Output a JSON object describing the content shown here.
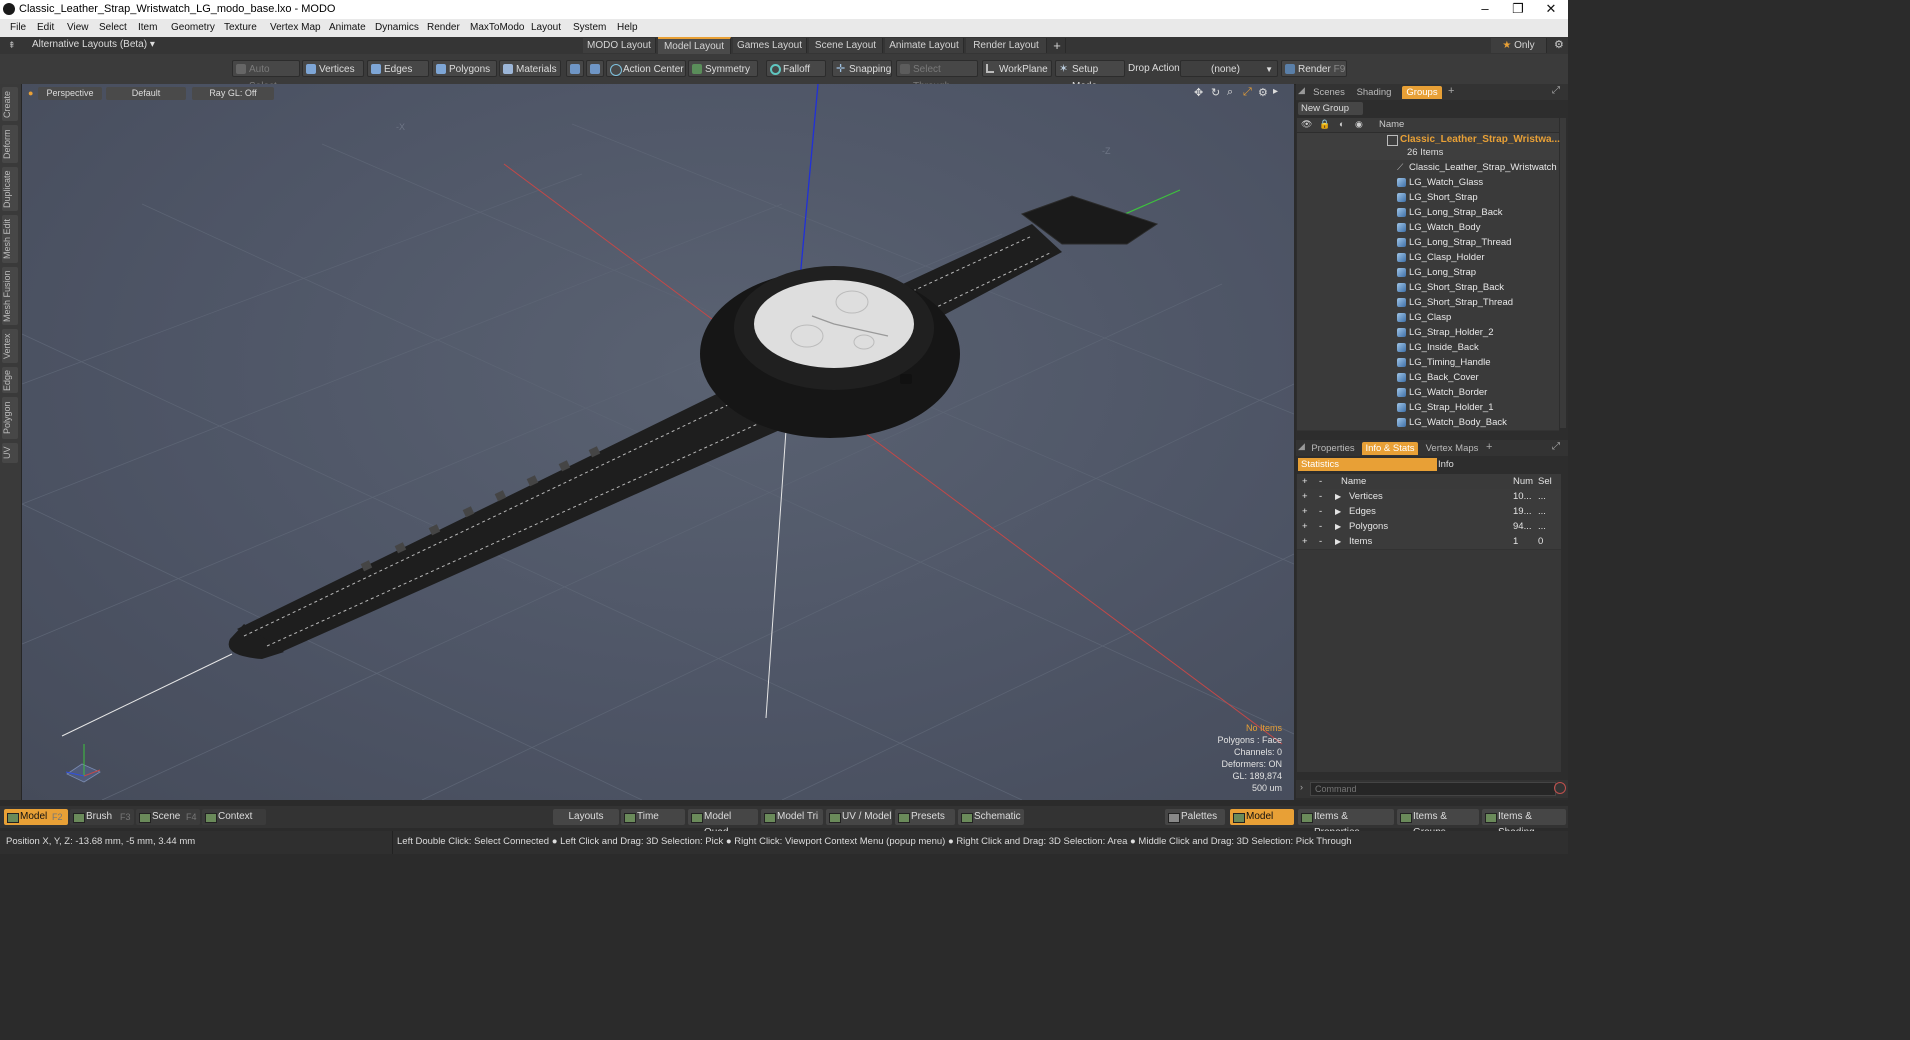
{
  "window": {
    "title": "Classic_Leather_Strap_Wristwatch_LG_modo_base.lxo - MODO"
  },
  "menu": [
    "File",
    "Edit",
    "View",
    "Select",
    "Item",
    "Geometry",
    "Texture",
    "Vertex Map",
    "Animate",
    "Dynamics",
    "Render",
    "MaxToModo",
    "Layout",
    "System",
    "Help"
  ],
  "layouts": {
    "selector": "Alternative Layouts (Beta)",
    "tabs": [
      "MODO Layout",
      "Model Layout",
      "Games Layout",
      "Scene Layout",
      "Animate Layout",
      "Render Layout"
    ],
    "active": "Model Layout",
    "add": "+",
    "only": "Only"
  },
  "toolbar": {
    "auto_select": "Auto Select",
    "vertices": "Vertices",
    "edges": "Edges",
    "polygons": "Polygons",
    "materials": "Materials",
    "action_center": "Action Center",
    "symmetry": "Symmetry",
    "falloff": "Falloff",
    "snapping": "Snapping",
    "select_through": "Select Through",
    "workplane": "WorkPlane",
    "setup_mode": "Setup Mode",
    "drop_action": "Drop Action",
    "drop_value": "(none)",
    "render": "Render",
    "render_key": "F9"
  },
  "left_tabs": [
    "Create",
    "Deform",
    "Duplicate",
    "Mesh Edit",
    "Mesh Fusion",
    "Vertex",
    "Edge",
    "Polygon",
    "UV"
  ],
  "viewport": {
    "view": "Perspective",
    "shading": "Default",
    "raygl": "Ray GL: Off",
    "stats": {
      "no_items": "No Items",
      "polygons": "Polygons : Face",
      "channels": "Channels: 0",
      "deformers": "Deformers: ON",
      "gl": "GL: 189,874",
      "scale": "500 um"
    }
  },
  "groups_panel": {
    "tabs": [
      "Scenes",
      "Shading",
      "Groups"
    ],
    "active": "Groups",
    "new_group": "New Group",
    "col_name": "Name",
    "group_name": "Classic_Leather_Strap_Wristwa...",
    "group_count": "26 Items",
    "items": [
      "Classic_Leather_Strap_Wristwatch ...",
      "LG_Watch_Glass",
      "LG_Short_Strap",
      "LG_Long_Strap_Back",
      "LG_Watch_Body",
      "LG_Long_Strap_Thread",
      "LG_Clasp_Holder",
      "LG_Long_Strap",
      "LG_Short_Strap_Back",
      "LG_Short_Strap_Thread",
      "LG_Clasp",
      "LG_Strap_Holder_2",
      "LG_Inside_Back",
      "LG_Timing_Handle",
      "LG_Back_Cover",
      "LG_Watch_Border",
      "LG_Strap_Holder_1",
      "LG_Watch_Body_Back"
    ]
  },
  "stats_panel": {
    "tabs": [
      "Properties",
      "Info & Stats",
      "Vertex Maps"
    ],
    "active": "Info & Stats",
    "sub_statistics": "Statistics",
    "sub_info": "Info",
    "col_name": "Name",
    "col_num": "Num",
    "col_sel": "Sel",
    "rows": [
      {
        "name": "Vertices",
        "num": "10...",
        "sel": "..."
      },
      {
        "name": "Edges",
        "num": "19...",
        "sel": "..."
      },
      {
        "name": "Polygons",
        "num": "94...",
        "sel": "..."
      },
      {
        "name": "Items",
        "num": "1",
        "sel": "0"
      }
    ],
    "command_placeholder": "Command"
  },
  "bottom": {
    "model": "Model",
    "model_key": "F2",
    "brush": "Brush",
    "brush_key": "F3",
    "scene": "Scene",
    "scene_key": "F4",
    "context": "Context",
    "layouts": "Layouts",
    "time": "Time",
    "model_quad": "Model Quad",
    "model_tri": "Model Tri",
    "uv_model": "UV / Model",
    "presets": "Presets",
    "schematic": "Schematic",
    "palettes": "Palettes",
    "model2": "Model",
    "items_props": "Items & Properties",
    "items_groups": "Items & Groups",
    "items_shading": "Items & Shading"
  },
  "status": {
    "position": "Position X, Y, Z:   -13.68 mm, -5 mm, 3.44 mm",
    "hints": "Left Double Click: Select Connected ● Left Click and Drag: 3D Selection: Pick ● Right Click: Viewport Context Menu (popup menu) ● Right Click and Drag: 3D Selection: Area ● Middle Click and Drag: 3D Selection: Pick Through"
  },
  "colors": {
    "accent": "#e8a036",
    "viewport": "#4e5566",
    "panel": "#2d2d2d"
  }
}
